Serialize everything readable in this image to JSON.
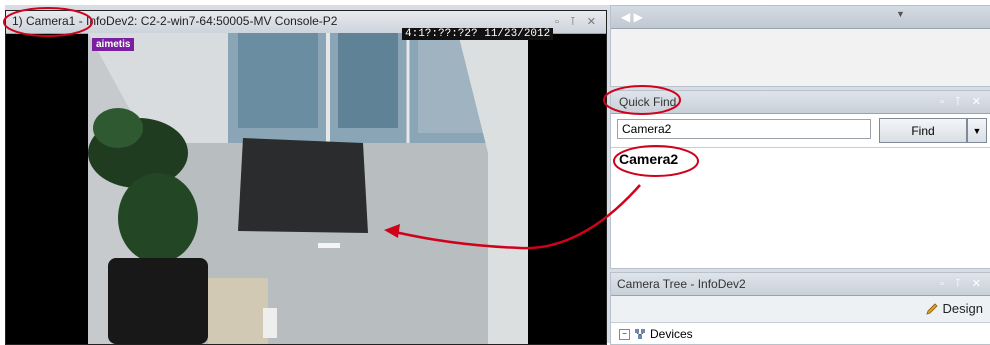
{
  "camera_window": {
    "title": "1) Camera1 - InfoDev2: C2-2-win7-64:50005-MV Console-P2",
    "window_buttons": "▫ ⊺ ✕",
    "overlay_logo": "aimetis",
    "timestamp": "4:1?:??:?2? 11/23/2012"
  },
  "quick_find": {
    "title": "Quick Find",
    "panel_buttons": "▫ ⊺ ✕",
    "input_value": "Camera2",
    "find_button": "Find",
    "dropdown_symbol": "▼",
    "result": "Camera2"
  },
  "camera_tree": {
    "title": "Camera Tree - InfoDev2",
    "panel_buttons": "▫ ⊺ ✕",
    "design_label": "Design",
    "root_item": "Devices"
  },
  "colors": {
    "annotation_red": "#d0021b",
    "logo_purple": "#7a1fa0"
  }
}
